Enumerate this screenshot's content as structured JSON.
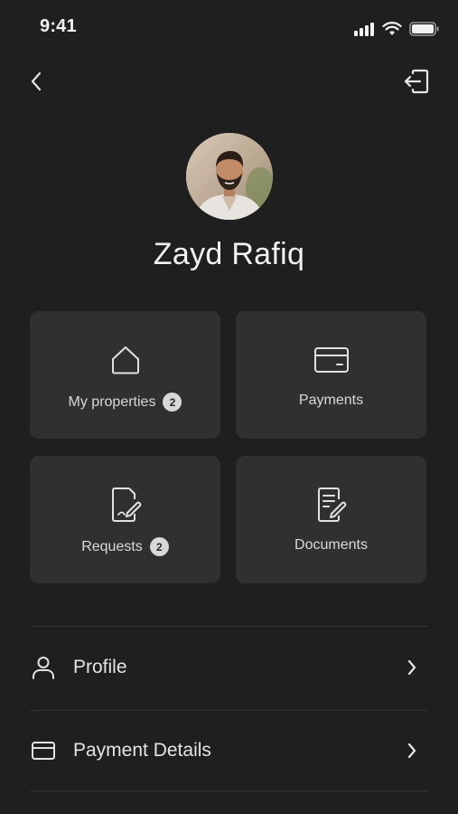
{
  "status_bar": {
    "time": "9:41"
  },
  "nav": {
    "back_icon": "chevron-left-icon",
    "logout_icon": "logout-icon"
  },
  "user": {
    "name": "Zayd Rafiq"
  },
  "tiles": [
    {
      "label": "My properties",
      "badge": "2",
      "icon": "house-icon"
    },
    {
      "label": "Payments",
      "icon": "card-icon"
    },
    {
      "label": "Requests",
      "badge": "2",
      "icon": "document-sign-icon"
    },
    {
      "label": "Documents",
      "icon": "document-edit-icon"
    }
  ],
  "menu": [
    {
      "label": "Profile",
      "icon": "person-icon"
    },
    {
      "label": "Payment Details",
      "icon": "card-icon"
    }
  ],
  "colors": {
    "background": "#1f1f1f",
    "tile": "#303030",
    "text": "#e4e4e4",
    "badge": "#d8d8d8"
  }
}
